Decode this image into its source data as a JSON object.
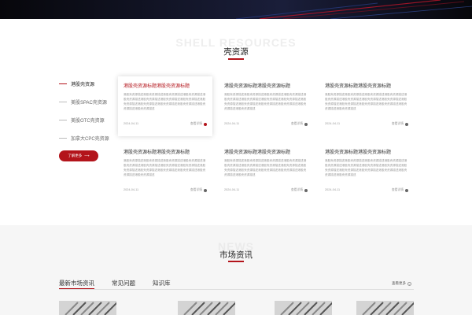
{
  "shell_section": {
    "ghost_title": "SHELL RESOURCES",
    "title": "壳资源",
    "nav_items": [
      {
        "label": "港股壳资源",
        "active": true
      },
      {
        "label": "美股SPAC壳资源",
        "active": false
      },
      {
        "label": "美股OTC壳资源",
        "active": false
      },
      {
        "label": "加拿大CPC壳资源",
        "active": false
      }
    ],
    "more_button": "了解更多",
    "more_arrow": "⟶",
    "cards": [
      {
        "title": "港股壳资源标题港股壳资源标题",
        "desc": "港股壳资源描述港股壳资源描述港股壳资源描述港股壳资源描述港股壳资源描述港股壳资源描述港股壳资源描述港股壳资源描述港股壳资源描述港股壳资源描述港股壳资源描述港股壳资源描述港股壳资源描述港股壳资源描述",
        "date": "2024-04-11",
        "view": "查看详情",
        "active": true
      },
      {
        "title": "港股壳资源标题港股壳资源标题",
        "desc": "港股壳资源描述港股壳资源描述港股壳资源描述港股壳资源描述港股壳资源描述港股壳资源描述港股壳资源描述港股壳资源描述港股壳资源描述港股壳资源描述港股壳资源描述港股壳资源描述港股壳资源描述港股壳资源描述",
        "date": "2024-04-11",
        "view": "查看详情",
        "active": false
      },
      {
        "title": "港股壳资源标题港股壳资源标题",
        "desc": "港股壳资源描述港股壳资源描述港股壳资源描述港股壳资源描述港股壳资源描述港股壳资源描述港股壳资源描述港股壳资源描述港股壳资源描述港股壳资源描述港股壳资源描述港股壳资源描述港股壳资源描述港股壳资源描述",
        "date": "2024-04-11",
        "view": "查看详情",
        "active": false
      },
      {
        "title": "港股壳资源标题港股壳资源标题",
        "desc": "港股壳资源描述港股壳资源描述港股壳资源描述港股壳资源描述港股壳资源描述港股壳资源描述港股壳资源描述港股壳资源描述港股壳资源描述港股壳资源描述港股壳资源描述港股壳资源描述港股壳资源描述港股壳资源描述",
        "date": "2024-04-11",
        "view": "查看详情",
        "active": false
      },
      {
        "title": "港股壳资源标题港股壳资源标题",
        "desc": "港股壳资源描述港股壳资源描述港股壳资源描述港股壳资源描述港股壳资源描述港股壳资源描述港股壳资源描述港股壳资源描述港股壳资源描述港股壳资源描述港股壳资源描述港股壳资源描述港股壳资源描述港股壳资源描述",
        "date": "2024-04-11",
        "view": "查看详情",
        "active": false
      },
      {
        "title": "港股壳资源标题港股壳资源标题",
        "desc": "港股壳资源描述港股壳资源描述港股壳资源描述港股壳资源描述港股壳资源描述港股壳资源描述港股壳资源描述港股壳资源描述港股壳资源描述港股壳资源描述港股壳资源描述港股壳资源描述港股壳资源描述港股壳资源描述",
        "date": "2024-04-11",
        "view": "查看详情",
        "active": false
      }
    ]
  },
  "news_section": {
    "ghost_title": "NEWS",
    "title": "市场资讯",
    "tabs": [
      {
        "label": "最新市场资讯",
        "active": true
      },
      {
        "label": "常见问题",
        "active": false
      },
      {
        "label": "知识库",
        "active": false
      }
    ],
    "view_more": "查看更多",
    "view_more_icon": "›",
    "thumb_count": 4
  },
  "colors": {
    "accent": "#b3141b",
    "hero_bg": "#07070b",
    "news_bg": "#f6f6f6"
  },
  "icons": {
    "card_dot": "dot-icon",
    "more_arrow": "arrow-right-icon",
    "view_more": "circle-chevron-icon"
  }
}
